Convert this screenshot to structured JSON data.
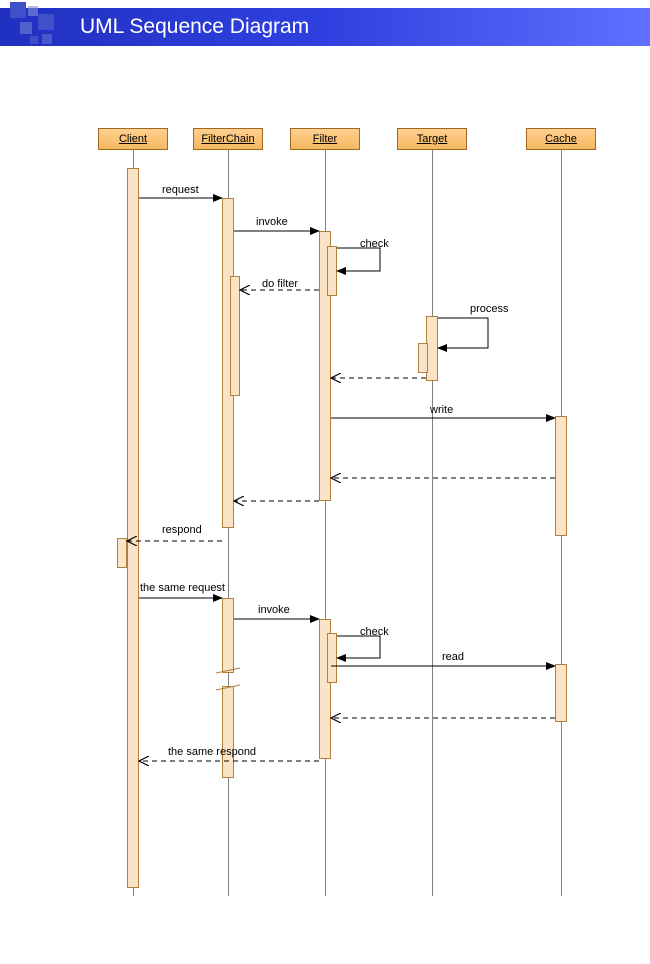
{
  "title": "UML Sequence Diagram",
  "participants": {
    "p0": "Client",
    "p1": "FilterChain",
    "p2": "Filter",
    "p3": "Target",
    "p4": "Cache"
  },
  "messages": {
    "m1": "request",
    "m2": "invoke",
    "m3": "check",
    "m4": "do filter",
    "m5": "process",
    "m6": "write",
    "m7": "respond",
    "m8": "the same request",
    "m9": "invoke",
    "m10": "check",
    "m11": "read",
    "m12": "the same respond"
  },
  "colors": {
    "header_start": "#2030c0",
    "header_end": "#6070ff",
    "box_fill": "#ffd090",
    "box_border": "#a06820",
    "activation": "#fbe3c6"
  }
}
